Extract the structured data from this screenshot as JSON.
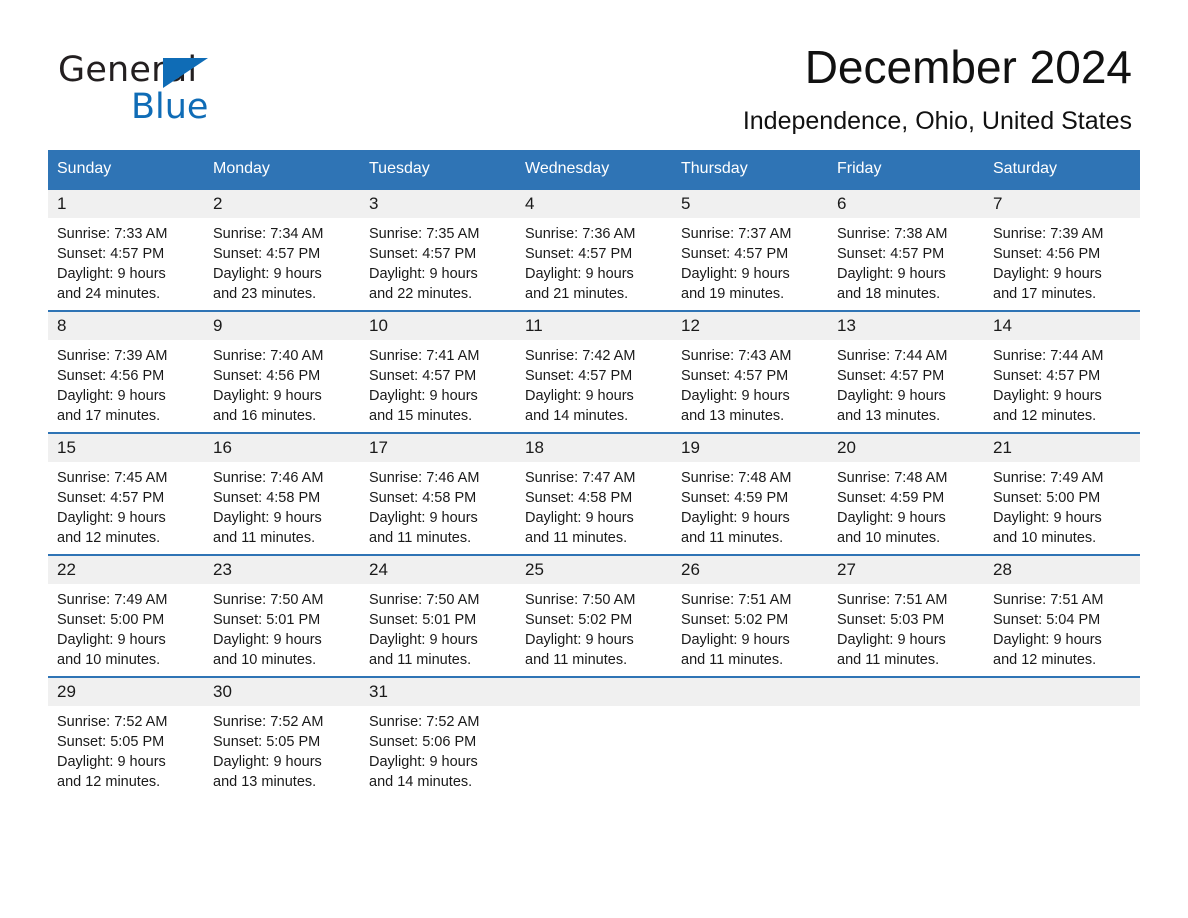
{
  "brand": {
    "name_part1": "General",
    "name_part2": "Blue",
    "accent_color": "#0f6cb6"
  },
  "header": {
    "title": "December 2024",
    "location": "Independence, Ohio, United States"
  },
  "theme": {
    "header_row_bg": "#2f74b5",
    "date_band_bg": "#f0f0f0",
    "row_border": "#2f74b5",
    "text": "#1a1a1a"
  },
  "weekdays": [
    "Sunday",
    "Monday",
    "Tuesday",
    "Wednesday",
    "Thursday",
    "Friday",
    "Saturday"
  ],
  "weeks": [
    [
      {
        "day": "1",
        "sunrise": "Sunrise: 7:33 AM",
        "sunset": "Sunset: 4:57 PM",
        "daylight_line1": "Daylight: 9 hours",
        "daylight_line2": "and 24 minutes."
      },
      {
        "day": "2",
        "sunrise": "Sunrise: 7:34 AM",
        "sunset": "Sunset: 4:57 PM",
        "daylight_line1": "Daylight: 9 hours",
        "daylight_line2": "and 23 minutes."
      },
      {
        "day": "3",
        "sunrise": "Sunrise: 7:35 AM",
        "sunset": "Sunset: 4:57 PM",
        "daylight_line1": "Daylight: 9 hours",
        "daylight_line2": "and 22 minutes."
      },
      {
        "day": "4",
        "sunrise": "Sunrise: 7:36 AM",
        "sunset": "Sunset: 4:57 PM",
        "daylight_line1": "Daylight: 9 hours",
        "daylight_line2": "and 21 minutes."
      },
      {
        "day": "5",
        "sunrise": "Sunrise: 7:37 AM",
        "sunset": "Sunset: 4:57 PM",
        "daylight_line1": "Daylight: 9 hours",
        "daylight_line2": "and 19 minutes."
      },
      {
        "day": "6",
        "sunrise": "Sunrise: 7:38 AM",
        "sunset": "Sunset: 4:57 PM",
        "daylight_line1": "Daylight: 9 hours",
        "daylight_line2": "and 18 minutes."
      },
      {
        "day": "7",
        "sunrise": "Sunrise: 7:39 AM",
        "sunset": "Sunset: 4:56 PM",
        "daylight_line1": "Daylight: 9 hours",
        "daylight_line2": "and 17 minutes."
      }
    ],
    [
      {
        "day": "8",
        "sunrise": "Sunrise: 7:39 AM",
        "sunset": "Sunset: 4:56 PM",
        "daylight_line1": "Daylight: 9 hours",
        "daylight_line2": "and 17 minutes."
      },
      {
        "day": "9",
        "sunrise": "Sunrise: 7:40 AM",
        "sunset": "Sunset: 4:56 PM",
        "daylight_line1": "Daylight: 9 hours",
        "daylight_line2": "and 16 minutes."
      },
      {
        "day": "10",
        "sunrise": "Sunrise: 7:41 AM",
        "sunset": "Sunset: 4:57 PM",
        "daylight_line1": "Daylight: 9 hours",
        "daylight_line2": "and 15 minutes."
      },
      {
        "day": "11",
        "sunrise": "Sunrise: 7:42 AM",
        "sunset": "Sunset: 4:57 PM",
        "daylight_line1": "Daylight: 9 hours",
        "daylight_line2": "and 14 minutes."
      },
      {
        "day": "12",
        "sunrise": "Sunrise: 7:43 AM",
        "sunset": "Sunset: 4:57 PM",
        "daylight_line1": "Daylight: 9 hours",
        "daylight_line2": "and 13 minutes."
      },
      {
        "day": "13",
        "sunrise": "Sunrise: 7:44 AM",
        "sunset": "Sunset: 4:57 PM",
        "daylight_line1": "Daylight: 9 hours",
        "daylight_line2": "and 13 minutes."
      },
      {
        "day": "14",
        "sunrise": "Sunrise: 7:44 AM",
        "sunset": "Sunset: 4:57 PM",
        "daylight_line1": "Daylight: 9 hours",
        "daylight_line2": "and 12 minutes."
      }
    ],
    [
      {
        "day": "15",
        "sunrise": "Sunrise: 7:45 AM",
        "sunset": "Sunset: 4:57 PM",
        "daylight_line1": "Daylight: 9 hours",
        "daylight_line2": "and 12 minutes."
      },
      {
        "day": "16",
        "sunrise": "Sunrise: 7:46 AM",
        "sunset": "Sunset: 4:58 PM",
        "daylight_line1": "Daylight: 9 hours",
        "daylight_line2": "and 11 minutes."
      },
      {
        "day": "17",
        "sunrise": "Sunrise: 7:46 AM",
        "sunset": "Sunset: 4:58 PM",
        "daylight_line1": "Daylight: 9 hours",
        "daylight_line2": "and 11 minutes."
      },
      {
        "day": "18",
        "sunrise": "Sunrise: 7:47 AM",
        "sunset": "Sunset: 4:58 PM",
        "daylight_line1": "Daylight: 9 hours",
        "daylight_line2": "and 11 minutes."
      },
      {
        "day": "19",
        "sunrise": "Sunrise: 7:48 AM",
        "sunset": "Sunset: 4:59 PM",
        "daylight_line1": "Daylight: 9 hours",
        "daylight_line2": "and 11 minutes."
      },
      {
        "day": "20",
        "sunrise": "Sunrise: 7:48 AM",
        "sunset": "Sunset: 4:59 PM",
        "daylight_line1": "Daylight: 9 hours",
        "daylight_line2": "and 10 minutes."
      },
      {
        "day": "21",
        "sunrise": "Sunrise: 7:49 AM",
        "sunset": "Sunset: 5:00 PM",
        "daylight_line1": "Daylight: 9 hours",
        "daylight_line2": "and 10 minutes."
      }
    ],
    [
      {
        "day": "22",
        "sunrise": "Sunrise: 7:49 AM",
        "sunset": "Sunset: 5:00 PM",
        "daylight_line1": "Daylight: 9 hours",
        "daylight_line2": "and 10 minutes."
      },
      {
        "day": "23",
        "sunrise": "Sunrise: 7:50 AM",
        "sunset": "Sunset: 5:01 PM",
        "daylight_line1": "Daylight: 9 hours",
        "daylight_line2": "and 10 minutes."
      },
      {
        "day": "24",
        "sunrise": "Sunrise: 7:50 AM",
        "sunset": "Sunset: 5:01 PM",
        "daylight_line1": "Daylight: 9 hours",
        "daylight_line2": "and 11 minutes."
      },
      {
        "day": "25",
        "sunrise": "Sunrise: 7:50 AM",
        "sunset": "Sunset: 5:02 PM",
        "daylight_line1": "Daylight: 9 hours",
        "daylight_line2": "and 11 minutes."
      },
      {
        "day": "26",
        "sunrise": "Sunrise: 7:51 AM",
        "sunset": "Sunset: 5:02 PM",
        "daylight_line1": "Daylight: 9 hours",
        "daylight_line2": "and 11 minutes."
      },
      {
        "day": "27",
        "sunrise": "Sunrise: 7:51 AM",
        "sunset": "Sunset: 5:03 PM",
        "daylight_line1": "Daylight: 9 hours",
        "daylight_line2": "and 11 minutes."
      },
      {
        "day": "28",
        "sunrise": "Sunrise: 7:51 AM",
        "sunset": "Sunset: 5:04 PM",
        "daylight_line1": "Daylight: 9 hours",
        "daylight_line2": "and 12 minutes."
      }
    ],
    [
      {
        "day": "29",
        "sunrise": "Sunrise: 7:52 AM",
        "sunset": "Sunset: 5:05 PM",
        "daylight_line1": "Daylight: 9 hours",
        "daylight_line2": "and 12 minutes."
      },
      {
        "day": "30",
        "sunrise": "Sunrise: 7:52 AM",
        "sunset": "Sunset: 5:05 PM",
        "daylight_line1": "Daylight: 9 hours",
        "daylight_line2": "and 13 minutes."
      },
      {
        "day": "31",
        "sunrise": "Sunrise: 7:52 AM",
        "sunset": "Sunset: 5:06 PM",
        "daylight_line1": "Daylight: 9 hours",
        "daylight_line2": "and 14 minutes."
      },
      {
        "day": "",
        "sunrise": "",
        "sunset": "",
        "daylight_line1": "",
        "daylight_line2": ""
      },
      {
        "day": "",
        "sunrise": "",
        "sunset": "",
        "daylight_line1": "",
        "daylight_line2": ""
      },
      {
        "day": "",
        "sunrise": "",
        "sunset": "",
        "daylight_line1": "",
        "daylight_line2": ""
      },
      {
        "day": "",
        "sunrise": "",
        "sunset": "",
        "daylight_line1": "",
        "daylight_line2": ""
      }
    ]
  ]
}
